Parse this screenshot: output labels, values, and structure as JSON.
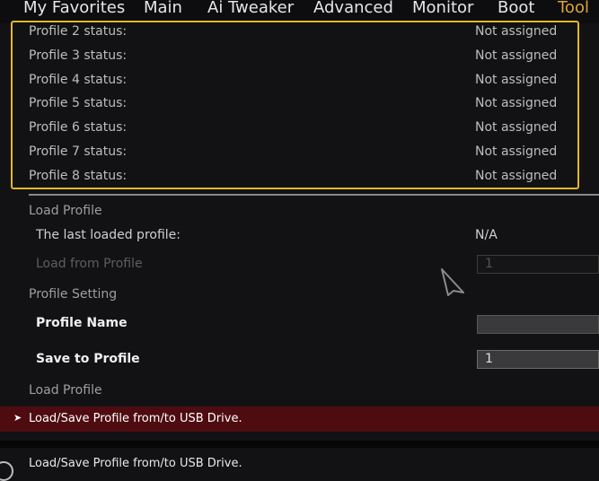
{
  "tabs": [
    {
      "label": "My Favorites",
      "active": false
    },
    {
      "label": "Main",
      "active": false
    },
    {
      "label": "Ai Tweaker",
      "active": false
    },
    {
      "label": "Advanced",
      "active": false
    },
    {
      "label": "Monitor",
      "active": false
    },
    {
      "label": "Boot",
      "active": false
    },
    {
      "label": "Tool",
      "active": true
    }
  ],
  "profile_statuses": [
    {
      "label": "Profile 2 status:",
      "value": "Not assigned"
    },
    {
      "label": "Profile 3 status:",
      "value": "Not assigned"
    },
    {
      "label": "Profile 4 status:",
      "value": "Not assigned"
    },
    {
      "label": "Profile 5 status:",
      "value": "Not assigned"
    },
    {
      "label": "Profile 6 status:",
      "value": "Not assigned"
    },
    {
      "label": "Profile 7 status:",
      "value": "Not assigned"
    },
    {
      "label": "Profile 8 status:",
      "value": "Not assigned"
    }
  ],
  "load_section": {
    "title": "Load Profile",
    "last_loaded_label": "The last loaded profile:",
    "last_loaded_value": "N/A",
    "load_from_label": "Load from Profile",
    "load_from_value": "1"
  },
  "setting_section": {
    "title": "Profile Setting",
    "name_label": "Profile Name",
    "name_value": "",
    "save_label": "Save to Profile",
    "save_value": "1"
  },
  "load_section_2": {
    "title": "Load Profile"
  },
  "usb_item": {
    "label": "Load/Save Profile from/to USB Drive."
  },
  "help_text": "Load/Save Profile from/to USB Drive.",
  "colors": {
    "accent_tab": "#d9a338",
    "highlight_border": "#e3b81f",
    "selected_bar": "#4e0c10"
  }
}
